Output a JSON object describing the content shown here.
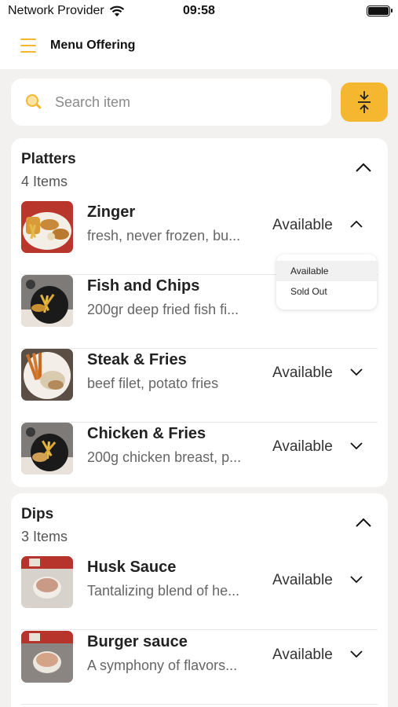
{
  "status_bar": {
    "provider": "Network Provider",
    "time": "09:58"
  },
  "app_bar": {
    "title": "Menu Offering"
  },
  "search": {
    "placeholder": "Search item",
    "value": ""
  },
  "categories": [
    {
      "name": "Platters",
      "count": "4 Items",
      "expanded": true,
      "items": [
        {
          "name": "Zinger",
          "description": "fresh, never frozen, bu...",
          "status": "Available",
          "dropdown_open": true
        },
        {
          "name": "Fish and Chips",
          "description": "200gr deep fried fish fi...",
          "status": "Available"
        },
        {
          "name": "Steak & Fries",
          "description": "beef filet, potato fries",
          "status": "Available"
        },
        {
          "name": "Chicken & Fries",
          "description": "200g chicken breast, p...",
          "status": "Available"
        }
      ]
    },
    {
      "name": "Dips",
      "count": "3 Items",
      "expanded": true,
      "items": [
        {
          "name": "Husk Sauce",
          "description": "Tantalizing blend of he...",
          "status": "Available"
        },
        {
          "name": "Burger sauce",
          "description": "A symphony of flavors...",
          "status": "Available"
        }
      ]
    }
  ],
  "status_dropdown": {
    "options": [
      "Available",
      "Sold Out"
    ],
    "selected": "Available"
  },
  "colors": {
    "accent": "#f5b630",
    "background": "#f2f1ef",
    "card": "#ffffff"
  }
}
